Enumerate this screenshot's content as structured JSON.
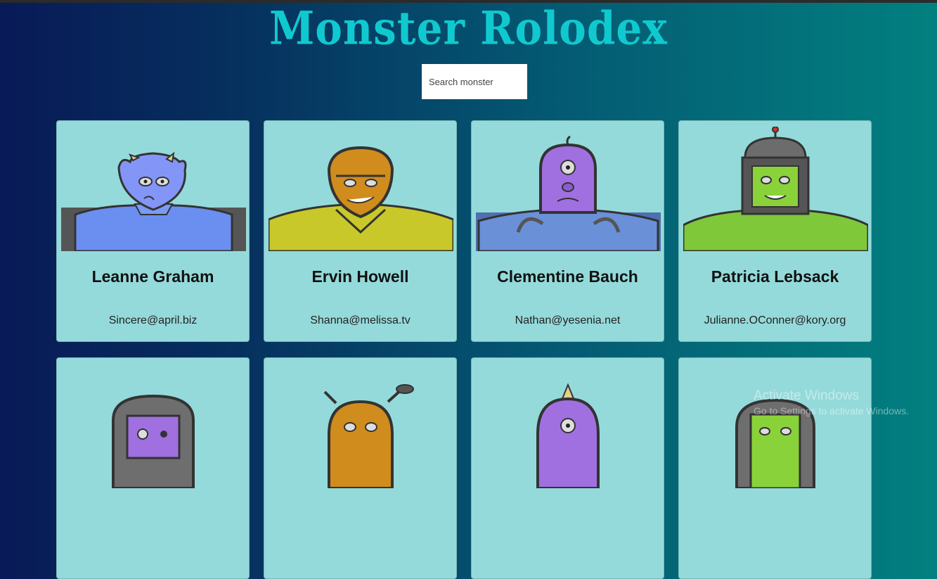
{
  "app": {
    "title": "Monster Rolodex"
  },
  "search": {
    "placeholder": "Search monster"
  },
  "monsters": [
    {
      "name": "Leanne Graham",
      "email": "Sincere@april.biz",
      "body_color": "#6b8ff0",
      "head_color": "#8396f7"
    },
    {
      "name": "Ervin Howell",
      "email": "Shanna@melissa.tv",
      "body_color": "#c8c82a",
      "head_color": "#d08c1c"
    },
    {
      "name": "Clementine Bauch",
      "email": "Nathan@yesenia.net",
      "body_color": "#6a90d8",
      "head_color": "#a070e0"
    },
    {
      "name": "Patricia Lebsack",
      "email": "Julianne.OConner@kory.org",
      "body_color": "#7ec83a",
      "head_color": "#8ad23a"
    },
    {
      "name": "",
      "email": "",
      "body_color": "#808080",
      "head_color": "#a070e0"
    },
    {
      "name": "",
      "email": "",
      "body_color": "#c8c82a",
      "head_color": "#d08c1c"
    },
    {
      "name": "",
      "email": "",
      "body_color": "#6a90d8",
      "head_color": "#a070e0"
    },
    {
      "name": "",
      "email": "",
      "body_color": "#7ec83a",
      "head_color": "#8ad23a"
    }
  ],
  "watermark": {
    "line1": "Activate Windows",
    "line2": "Go to Settings to activate Windows."
  }
}
